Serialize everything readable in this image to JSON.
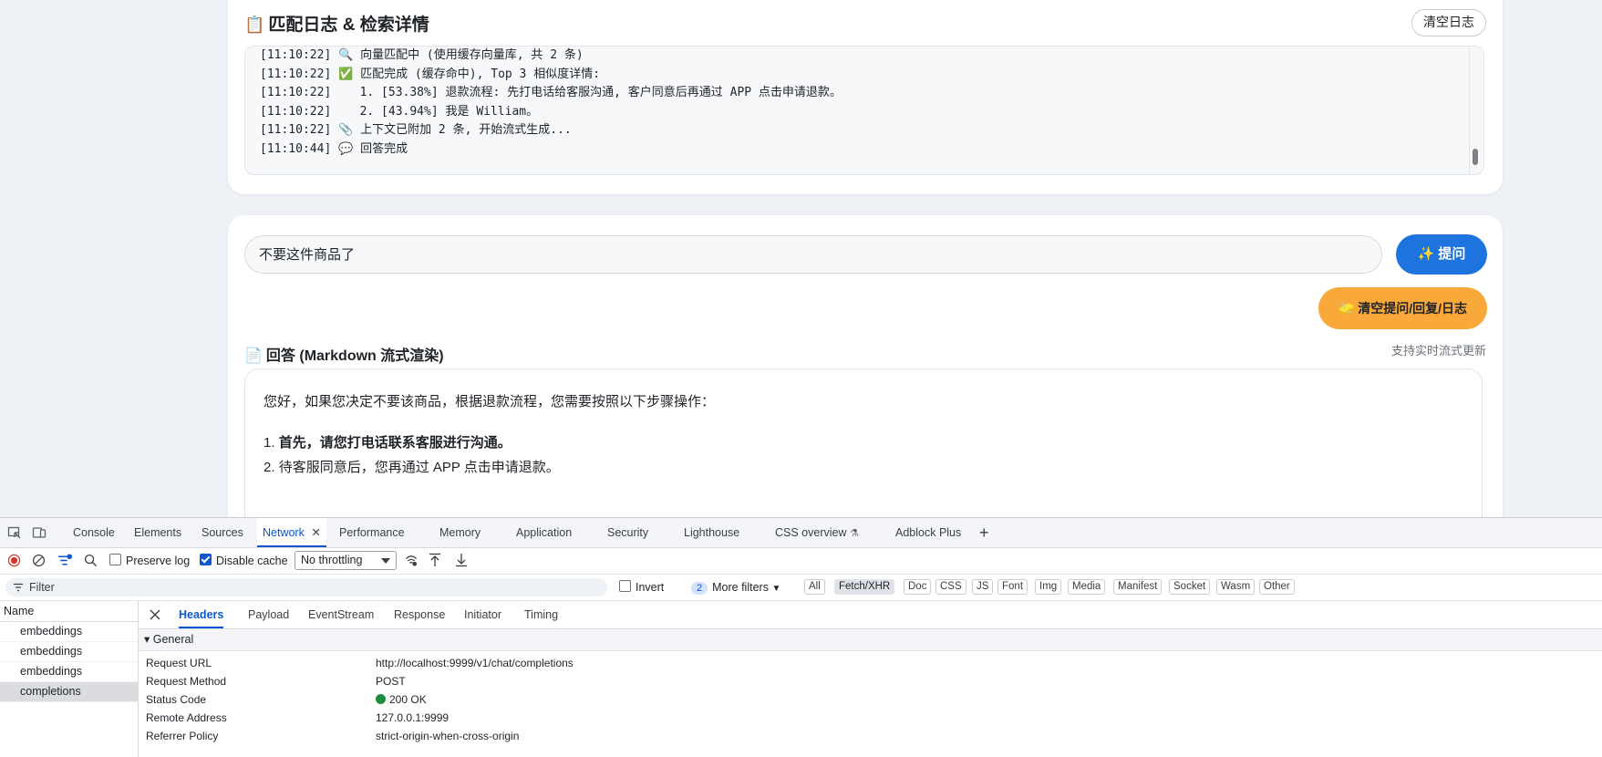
{
  "log_panel": {
    "icon": "📋",
    "title": "匹配日志 & 检索详情",
    "clear_button": "清空日志",
    "lines": [
      "[11:10:22] 🔍 向量匹配中 (使用缓存向量库, 共 2 条)",
      "[11:10:22] ✅ 匹配完成 (缓存命中), Top 3 相似度详情:",
      "[11:10:22]    1. [53.38%] 退款流程: 先打电话给客服沟通, 客户同意后再通过 APP 点击申请退款。",
      "[11:10:22]    2. [43.94%] 我是 William。",
      "[11:10:22] 📎 上下文已附加 2 条, 开始流式生成...",
      "[11:10:44] 💬 回答完成"
    ]
  },
  "qa_panel": {
    "question_value": "不要这件商品了",
    "ask_button": "✨ 提问",
    "clear_all_button": "🧽 清空提问/回复/日志",
    "answer_icon": "📄",
    "answer_title": "回答 (Markdown 流式渲染)",
    "answer_hint": "支持实时流式更新",
    "answer_intro": "您好，如果您决定不要该商品，根据退款流程，您需要按照以下步骤操作：",
    "answer_steps": [
      {
        "num": "1.",
        "text": "首先，请您打电话联系客服进行沟通。",
        "bold": true
      },
      {
        "num": "2.",
        "text": "待客服同意后，您再通过 APP 点击申请退款。",
        "bold": false
      }
    ]
  },
  "devtools": {
    "tabs": [
      "Console",
      "Elements",
      "Sources",
      "Network",
      "Performance",
      "Memory",
      "Application",
      "Security",
      "Lighthouse",
      "CSS overview",
      "Adblock Plus"
    ],
    "active_tab": "Network",
    "preserve_log": "Preserve log",
    "disable_cache": "Disable cache",
    "throttling": "No throttling",
    "filter_placeholder": "Filter",
    "invert": "Invert",
    "more_filters_count": "2",
    "more_filters": "More filters",
    "type_filters": [
      "All",
      "Fetch/XHR",
      "Doc",
      "CSS",
      "JS",
      "Font",
      "Img",
      "Media",
      "Manifest",
      "Socket",
      "Wasm",
      "Other"
    ],
    "active_type": "Fetch/XHR",
    "name_header": "Name",
    "requests": [
      "embeddings",
      "embeddings",
      "embeddings",
      "completions"
    ],
    "selected_request": "completions",
    "detail_tabs": [
      "Headers",
      "Payload",
      "EventStream",
      "Response",
      "Initiator",
      "Timing"
    ],
    "active_detail_tab": "Headers",
    "general_section": "▾ General",
    "general": [
      {
        "key": "Request URL",
        "value": "http://localhost:9999/v1/chat/completions"
      },
      {
        "key": "Request Method",
        "value": "POST"
      },
      {
        "key": "Status Code",
        "value": "200 OK"
      },
      {
        "key": "Remote Address",
        "value": "127.0.0.1:9999"
      },
      {
        "key": "Referrer Policy",
        "value": "strict-origin-when-cross-origin"
      }
    ],
    "status_color": "#1e8e3e",
    "accent_color": "#0b57d0"
  }
}
